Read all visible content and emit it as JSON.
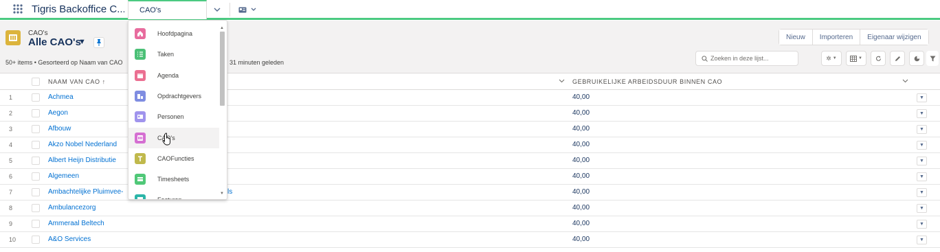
{
  "app": {
    "name": "Tigris Backoffice C..."
  },
  "nav": {
    "active_tab": "CAO's"
  },
  "header": {
    "object_label": "CAO's",
    "view_title": "Alle CAO's",
    "meta_left": "50+ items • Gesorteerd op Naam van CAO",
    "meta_right": "31 minuten geleden"
  },
  "buttons": {
    "new": "Nieuw",
    "import": "Importeren",
    "change_owner": "Eigenaar wijzigen"
  },
  "search": {
    "placeholder": "Zoeken in deze lijst..."
  },
  "table": {
    "columns": [
      "NAAM VAN CAO",
      "GEBRUIKELIJKE ARBEIDSDUUR BINNEN CAO"
    ],
    "rows": [
      {
        "num": "1",
        "name": "Achmea",
        "value": "40,00"
      },
      {
        "num": "2",
        "name": "Aegon",
        "value": "40,00"
      },
      {
        "num": "3",
        "name": "Afbouw",
        "value": "40,00"
      },
      {
        "num": "4",
        "name": "Akzo Nobel Nederland",
        "value": "40,00"
      },
      {
        "num": "5",
        "name": "Albert Heijn Distributie",
        "value": "40,00"
      },
      {
        "num": "6",
        "name": "Algemeen",
        "value": "40,00"
      },
      {
        "num": "7",
        "name": "Ambachtelijke Pluimvee-",
        "name_tail": "ls",
        "value": "40,00"
      },
      {
        "num": "8",
        "name": "Ambulancezorg",
        "value": "40,00"
      },
      {
        "num": "9",
        "name": "Ammeraal Beltech",
        "value": "40,00"
      },
      {
        "num": "10",
        "name": "A&O Services",
        "value": "40,00"
      }
    ]
  },
  "dropdown": {
    "items": [
      {
        "label": "Hoofdpagina",
        "icon": "home-icon",
        "color": "#e86c9e"
      },
      {
        "label": "Taken",
        "icon": "task-icon",
        "color": "#4bc076"
      },
      {
        "label": "Agenda",
        "icon": "calendar-icon",
        "color": "#eb7092"
      },
      {
        "label": "Opdrachtgevers",
        "icon": "account-icon",
        "color": "#7f8de1"
      },
      {
        "label": "Personen",
        "icon": "contact-icon",
        "color": "#a094ed"
      },
      {
        "label": "CAO's",
        "icon": "cao-icon",
        "color": "#d56fd2"
      },
      {
        "label": "CAOFuncties",
        "icon": "function-icon",
        "color": "#c0b94c"
      },
      {
        "label": "Timesheets",
        "icon": "timesheet-icon",
        "color": "#50c878"
      },
      {
        "label": "Facturen",
        "icon": "invoice-icon",
        "color": "#2bb5a8"
      }
    ]
  },
  "colors": {
    "accent": "#4bca81",
    "link": "#0070d2",
    "object": "#dcb43c"
  }
}
